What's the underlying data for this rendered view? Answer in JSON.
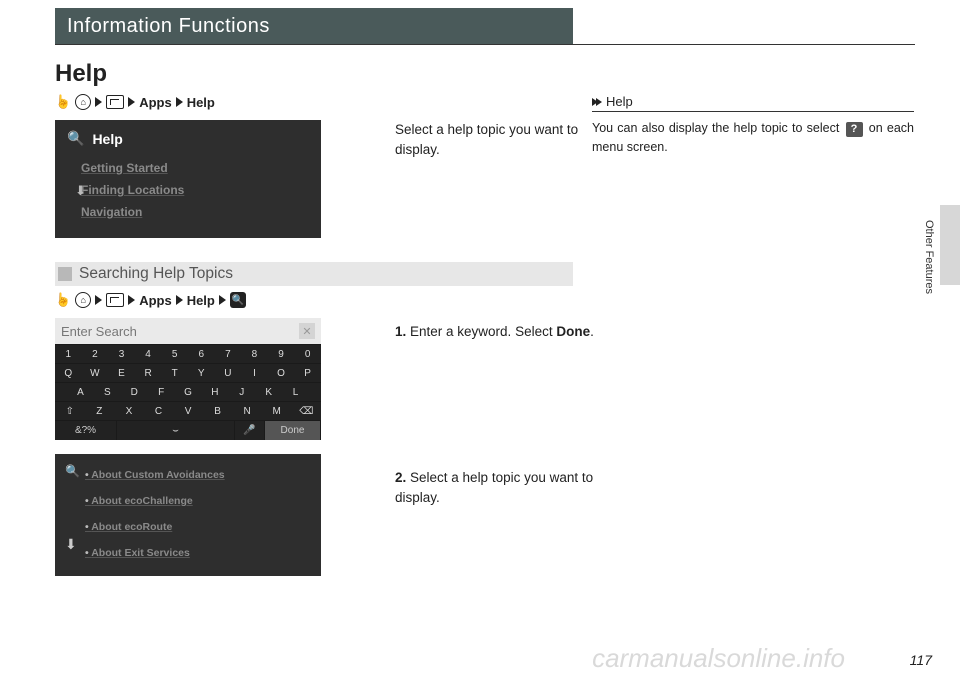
{
  "header": {
    "title": "Information Functions"
  },
  "help_title": "Help",
  "breadcrumb1": {
    "apps": "Apps",
    "help": "Help"
  },
  "panel1": {
    "title": "Help",
    "items": [
      "Getting Started",
      "Finding Locations",
      "Navigation"
    ]
  },
  "desc1": "Select a help topic you want to display.",
  "sub_heading": "Searching Help Topics",
  "breadcrumb2": {
    "apps": "Apps",
    "help": "Help"
  },
  "keyboard": {
    "placeholder": "Enter Search",
    "row_num": [
      "1",
      "2",
      "3",
      "4",
      "5",
      "6",
      "7",
      "8",
      "9",
      "0"
    ],
    "row_q": [
      "Q",
      "W",
      "E",
      "R",
      "T",
      "Y",
      "U",
      "I",
      "O",
      "P"
    ],
    "row_a": [
      "A",
      "S",
      "D",
      "F",
      "G",
      "H",
      "J",
      "K",
      "L"
    ],
    "row_z": [
      "⇧",
      "Z",
      "X",
      "C",
      "V",
      "B",
      "N",
      "M",
      "⌫"
    ],
    "sym": "&?%",
    "done": "Done"
  },
  "step1": {
    "num": "1.",
    "text": " Enter a keyword. Select ",
    "bold": "Done",
    "tail": "."
  },
  "results": {
    "items": [
      "About Custom Avoidances",
      "About ecoChallenge",
      "About ecoRoute",
      "About Exit Services"
    ]
  },
  "step2": {
    "num": "2.",
    "text": " Select a help topic you want to display."
  },
  "side": {
    "head": "Help",
    "body_pre": "You can also display the help topic to select ",
    "q": "?",
    "body_post": " on each menu screen."
  },
  "side_tab_label": "Other Features",
  "page_number": "117",
  "watermark": "carmanualsonline.info",
  "chart_data": null
}
